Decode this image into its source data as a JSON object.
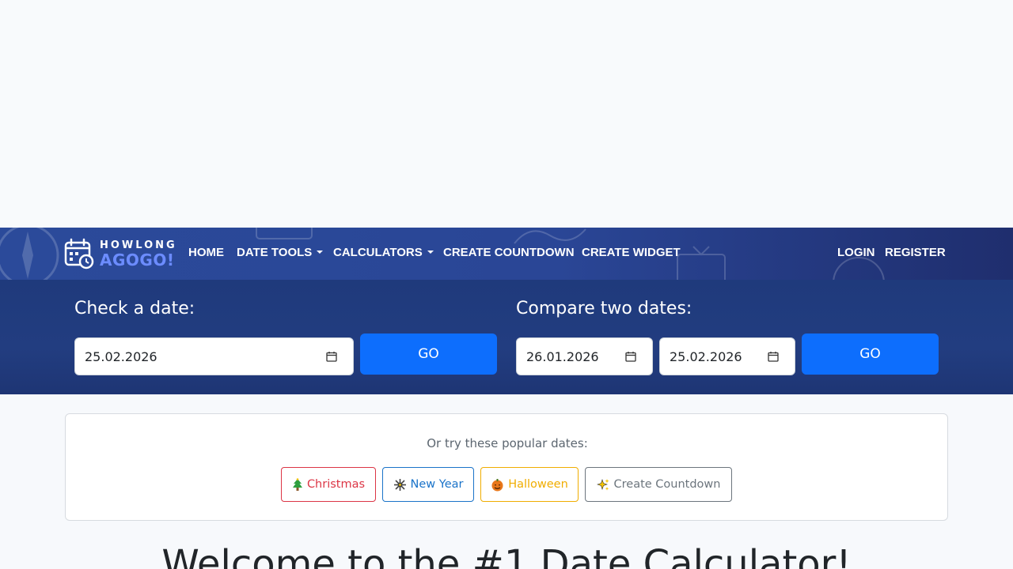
{
  "brand": {
    "line1": "HOWLONG",
    "line2": "AGOGO!",
    "accent": "#6c8cff"
  },
  "nav": {
    "home": "HOME",
    "date_tools": "DATE TOOLS",
    "calculators": "CALCULATORS",
    "create_countdown": "CREATE COUNTDOWN",
    "create_widget": "CREATE WIDGET",
    "login": "LOGIN",
    "register": "REGISTER"
  },
  "check_date": {
    "heading": "Check a date:",
    "value": "25.02.2026",
    "go_label": "GO"
  },
  "compare_dates": {
    "heading": "Compare two dates:",
    "start_value": "26.01.2026",
    "end_value": "25.02.2026",
    "go_label": "GO"
  },
  "popular": {
    "label": "Or try these popular dates:",
    "chips": [
      {
        "label": "Christmas",
        "icon": "christmas-tree-icon",
        "color": "#dc3545"
      },
      {
        "label": "New Year",
        "icon": "fireworks-icon",
        "color": "#1a73c9"
      },
      {
        "label": "Halloween",
        "icon": "pumpkin-icon",
        "color": "#f0ad00"
      },
      {
        "label": "Create Countdown",
        "icon": "sparkles-icon",
        "color": "#6c757d"
      }
    ]
  },
  "welcome": {
    "title": "Welcome to the #1 Date Calculator!"
  },
  "colors": {
    "primary": "#0d6efd",
    "navbar": "#2b4a9a",
    "band": "#1f3a7c"
  }
}
